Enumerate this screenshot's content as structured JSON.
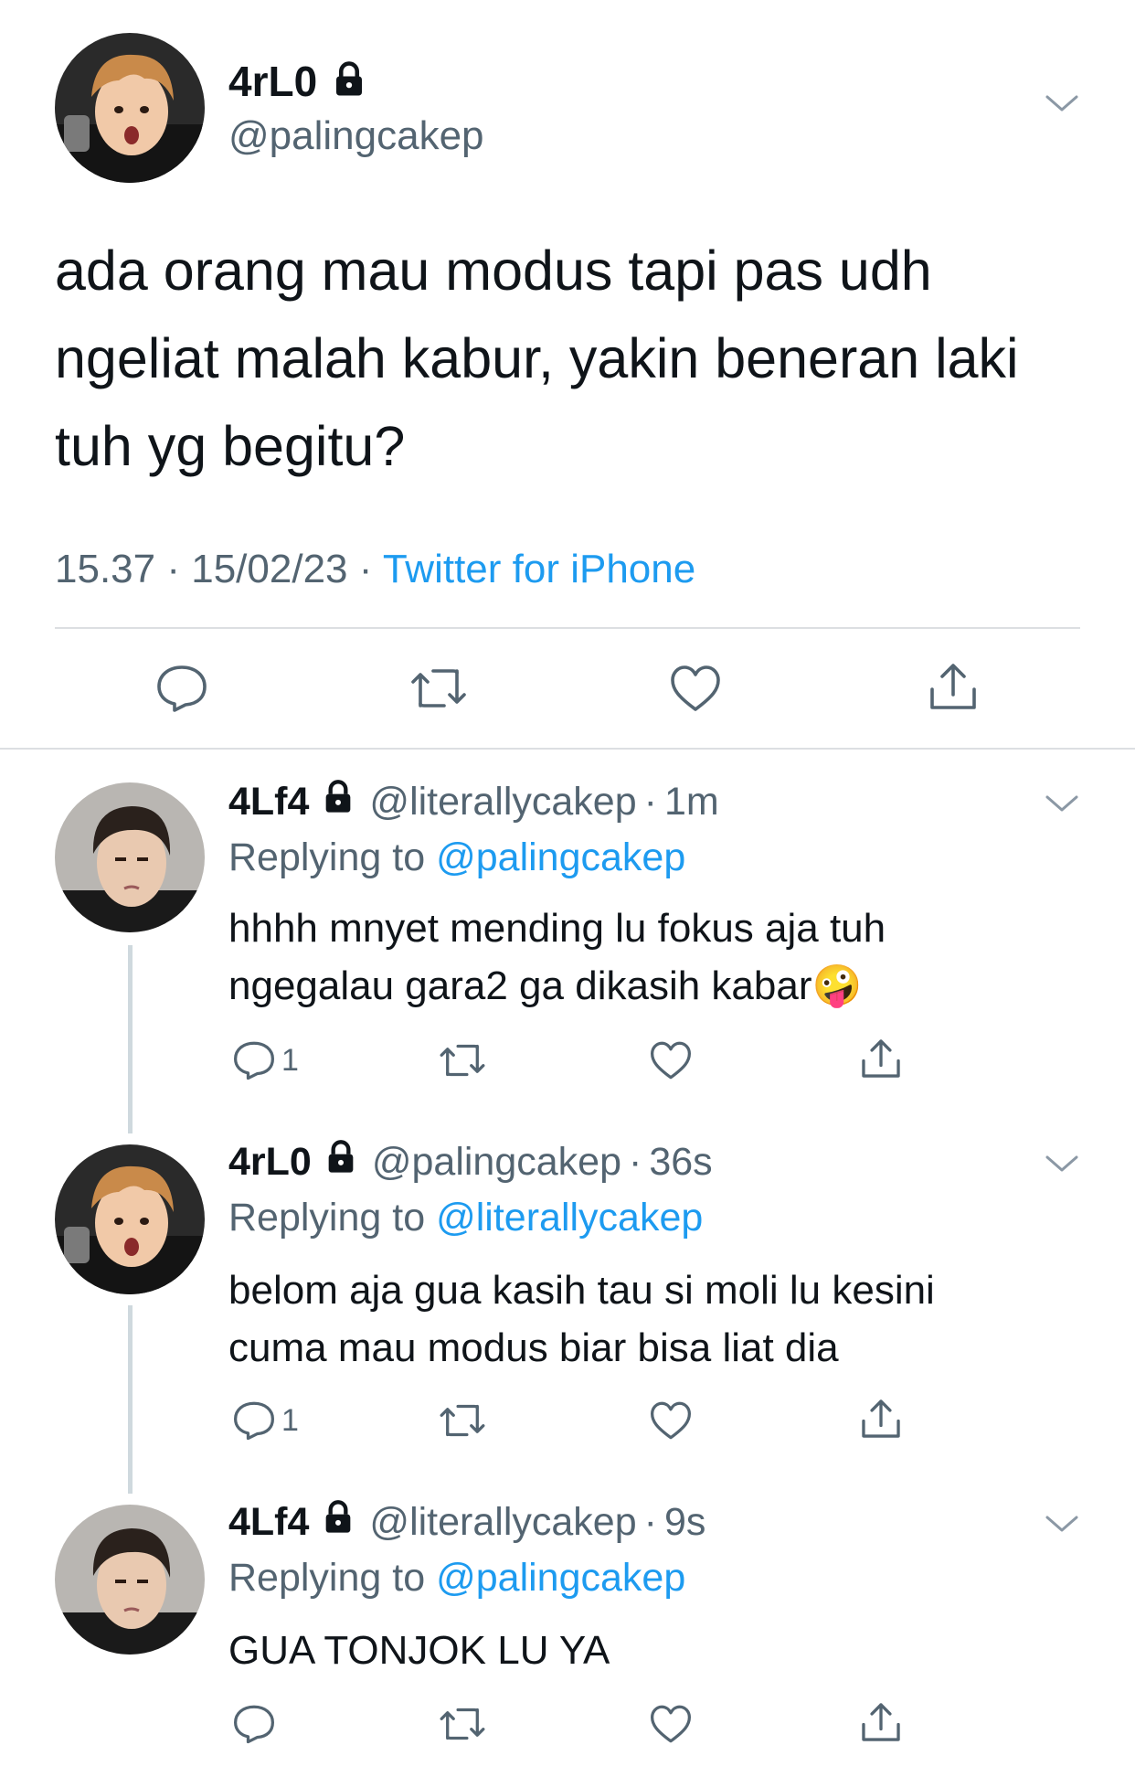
{
  "main_tweet": {
    "display_name": "4rL0",
    "handle": "@palingcakep",
    "text": "ada orang mau modus tapi pas udh ngeliat malah kabur, yakin beneran laki tuh yg begitu?",
    "time": "15.37",
    "date": "15/02/23",
    "separator": "·",
    "source": "Twitter for iPhone"
  },
  "replies": [
    {
      "display_name": "4Lf4",
      "handle": "@literallycakep",
      "time": "1m",
      "replying_prefix": "Replying to",
      "replying_to": "@palingcakep",
      "text": "hhhh mnyet mending lu fokus aja tuh ngegalau gara2 ga dikasih kabar",
      "emoji": "🤪",
      "reply_count": "1"
    },
    {
      "display_name": "4rL0",
      "handle": "@palingcakep",
      "time": "36s",
      "replying_prefix": "Replying to",
      "replying_to": "@literallycakep",
      "text": "belom aja gua kasih tau si moli lu kesini cuma mau modus biar bisa liat dia",
      "reply_count": "1"
    },
    {
      "display_name": "4Lf4",
      "handle": "@literallycakep",
      "time": "9s",
      "replying_prefix": "Replying to",
      "replying_to": "@palingcakep",
      "text": "GUA TONJOK LU YA",
      "reply_count": ""
    }
  ],
  "icons": {
    "more": "chevron-down-icon",
    "lock": "lock-icon",
    "reply": "reply-icon",
    "retweet": "retweet-icon",
    "like": "heart-icon",
    "share": "share-icon"
  },
  "colors": {
    "link": "#1d9bf0",
    "muted": "#536471",
    "text": "#0f1419",
    "divider": "#dcdfe2"
  }
}
